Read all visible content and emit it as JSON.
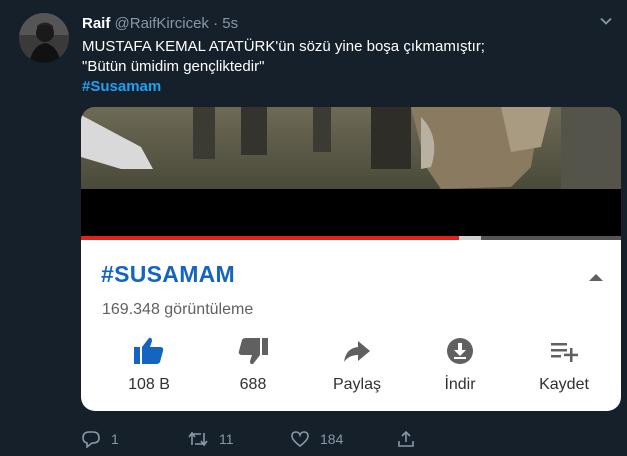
{
  "tweet": {
    "name": "Raif",
    "handle": "@RaifKircicek",
    "separator": "·",
    "time": "5s",
    "text_line1": "MUSTAFA KEMAL ATATÜRK'ün sözü yine boşa çıkmamıştır;",
    "text_line2": "\"Bütün ümidim  gençliktedir\"",
    "hashtag": "#Susamam"
  },
  "video_card": {
    "title": "#SUSAMAM",
    "views": "169.348 görüntüleme",
    "progress_played_fraction": 0.7,
    "progress_buffered_fraction": 0.74,
    "actions": [
      {
        "label": "108 B",
        "icon": "thumbs-up-icon"
      },
      {
        "label": "688",
        "icon": "thumbs-down-icon"
      },
      {
        "label": "Paylaş",
        "icon": "share-icon"
      },
      {
        "label": "İndir",
        "icon": "download-icon"
      },
      {
        "label": "Kaydet",
        "icon": "playlist-add-icon"
      }
    ]
  },
  "footer": {
    "replies": "1",
    "retweets": "11",
    "likes": "184"
  },
  "colors": {
    "background": "#15202b",
    "link": "#1da1f2",
    "muted": "#8899a6",
    "yt_title": "#1565c0",
    "yt_accent": "#1565c0",
    "progress": "#e62117"
  }
}
